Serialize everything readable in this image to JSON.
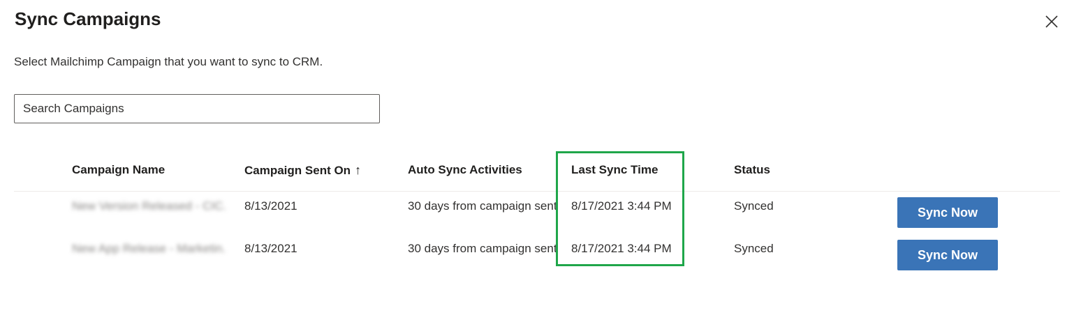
{
  "dialog": {
    "title": "Sync Campaigns",
    "subtitle": "Select Mailchimp Campaign that you want to sync to CRM.",
    "search_placeholder": "Search Campaigns"
  },
  "table": {
    "columns": {
      "campaign_name": "Campaign Name",
      "sent_on": "Campaign Sent On",
      "sent_on_sort_indicator": "↑",
      "auto_sync": "Auto Sync Activities",
      "last_sync": "Last Sync Time",
      "status": "Status"
    },
    "rows": [
      {
        "campaign_name": "New Version Released - CIC...",
        "sent_on": "8/13/2021",
        "auto_sync": "30 days from campaign sent",
        "last_sync": "8/17/2021 3:44 PM",
        "status": "Synced",
        "action": "Sync Now"
      },
      {
        "campaign_name": "New App Release - Marketin...",
        "sent_on": "8/13/2021",
        "auto_sync": "30 days from campaign sent",
        "last_sync": "8/17/2021 3:44 PM",
        "status": "Synced",
        "action": "Sync Now"
      }
    ]
  },
  "colors": {
    "accent": "#3a74b7",
    "highlight": "#1fa64a"
  }
}
